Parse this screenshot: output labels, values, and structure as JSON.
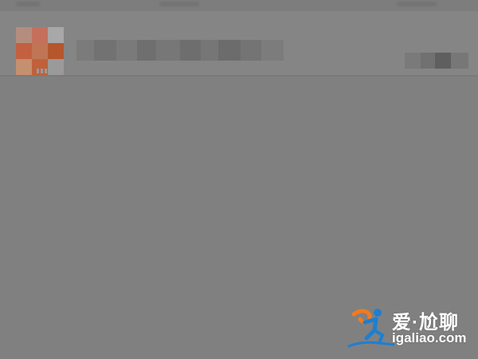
{
  "screen": {
    "background": "#808080"
  },
  "chat_list": {
    "rows": [
      {
        "avatar_colors": [
          "#b58d7e",
          "#c4705c",
          "#a8a8a8",
          "#c2603f",
          "#c07555",
          "#b5562c",
          "#c4906f",
          "#c0613a",
          "#9a9a9a"
        ]
      }
    ]
  },
  "watermark": {
    "title": "爱·尬聊",
    "url": "igaliao.com",
    "accent_colors": [
      "#1d7fd1",
      "#f07b1f"
    ]
  }
}
